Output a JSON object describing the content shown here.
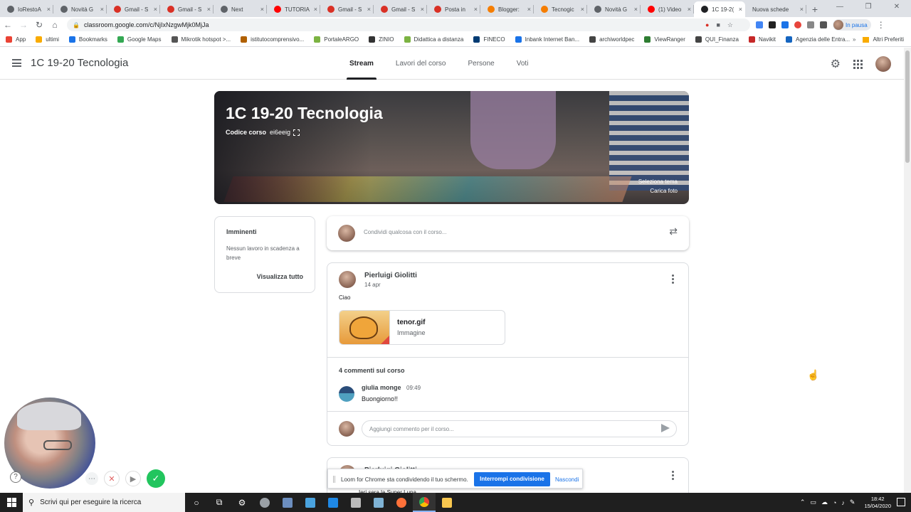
{
  "browser": {
    "tabs": [
      {
        "label": "IoRestoA",
        "icon": "world-icon",
        "color": "#5f6368"
      },
      {
        "label": "Novità G",
        "icon": "world-icon",
        "color": "#5f6368"
      },
      {
        "label": "Gmail - S",
        "icon": "gmail-icon",
        "color": "#d93025"
      },
      {
        "label": "Gmail - S",
        "icon": "gmail-icon",
        "color": "#d93025"
      },
      {
        "label": "Next",
        "icon": "next-icon",
        "color": "#5f6368"
      },
      {
        "label": "TUTORIA",
        "icon": "youtube-icon",
        "color": "#ff0000"
      },
      {
        "label": "Gmail - S",
        "icon": "gmail-icon",
        "color": "#d93025"
      },
      {
        "label": "Gmail - S",
        "icon": "gmail-icon",
        "color": "#d93025"
      },
      {
        "label": "Posta in",
        "icon": "gmail-icon",
        "color": "#d93025"
      },
      {
        "label": "Blogger:",
        "icon": "blogger-icon",
        "color": "#f57d00"
      },
      {
        "label": "Tecnogic",
        "icon": "blogger-icon",
        "color": "#f57d00"
      },
      {
        "label": "Novità G",
        "icon": "world-icon",
        "color": "#5f6368"
      },
      {
        "label": "(1) Video",
        "icon": "youtube-icon",
        "color": "#ff0000"
      },
      {
        "label": "1C 19-2(",
        "icon": "classroom-icon",
        "color": "#202124"
      }
    ],
    "new_tab_label": "Nuova schede",
    "url": "classroom.google.com/c/NjIxNzgwMjk0MjJa",
    "profile_label": "In pausa",
    "bookmarks": [
      {
        "label": "App",
        "color": "#ea4335"
      },
      {
        "label": "ultimi",
        "color": "#f9ab00"
      },
      {
        "label": "Bookmarks",
        "color": "#1a73e8"
      },
      {
        "label": "Google Maps",
        "color": "#34a853"
      },
      {
        "label": "Mikrotik hotspot >...",
        "color": "#555555"
      },
      {
        "label": "istitutocomprensivo...",
        "color": "#b06000"
      },
      {
        "label": "PortaleARGO",
        "color": "#7cb342"
      },
      {
        "label": "ZINIO",
        "color": "#333333"
      },
      {
        "label": "Didattica a distanza",
        "color": "#7cb342"
      },
      {
        "label": "FINECO",
        "color": "#003b73"
      },
      {
        "label": "Inbank Internet Ban...",
        "color": "#1a73e8"
      },
      {
        "label": "archiworldpec",
        "color": "#444444"
      },
      {
        "label": "ViewRanger",
        "color": "#2e7d32"
      },
      {
        "label": "QUI_Finanza",
        "color": "#444444"
      },
      {
        "label": "Navikit",
        "color": "#c62828"
      },
      {
        "label": "Agenzia delle Entra...",
        "color": "#1565c0"
      }
    ],
    "other_bookmarks": "Altri Preferiti"
  },
  "classroom": {
    "title": "1C 19-20 Tecnologia",
    "tabs": [
      "Stream",
      "Lavori del corso",
      "Persone",
      "Voti"
    ],
    "banner": {
      "title": "1C 19-20 Tecnologia",
      "code_label": "Codice corso",
      "code": "ei6eeig",
      "select_theme": "Seleziona tema",
      "upload_photo": "Carica foto"
    },
    "upcoming": {
      "title": "Imminenti",
      "empty": "Nessun lavoro in scadenza a breve",
      "view_all": "Visualizza tutto"
    },
    "share_placeholder": "Condividi qualcosa con il corso...",
    "post": {
      "author": "Pierluigi Giolitti",
      "date": "14 apr",
      "text": "Ciao",
      "attachment_name": "tenor.gif",
      "attachment_type": "Immagine",
      "comments_count": "4 commenti sul corso",
      "comment_author": "giulia monge",
      "comment_time": "09:49",
      "comment_text": "Buongiorno!!",
      "reply_placeholder": "Aggiungi commento per il corso..."
    },
    "post2": {
      "author": "Pierluigi Giolitti",
      "text": "Ieri sera la Super Luna"
    }
  },
  "loom": {
    "sharing_text": "Loom for Chrome sta condividendo il tuo schermo.",
    "stop_button": "Interrompi condivisione",
    "hide_button": "Nascondi"
  },
  "taskbar": {
    "search_placeholder": "Scrivi qui per eseguire la ricerca",
    "time": "18:42",
    "date": "15/04/2020"
  }
}
